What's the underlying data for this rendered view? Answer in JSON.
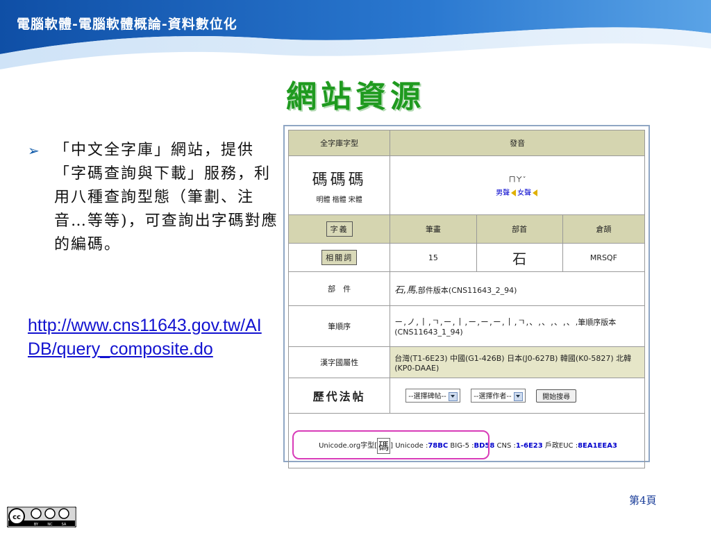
{
  "deck_title": "電腦軟體-電腦軟體概論-資料數位化",
  "slide_title": "網站資源",
  "bullet": {
    "text": "「中文全字庫」網站，提供「字碼查詢與下載」服務，利用八種查詢型態（筆劃、注音…等等)，可查詢出字碼對應的編碼。"
  },
  "link": "http://www.cns11643.gov.tw/AIDB/query_composite.do",
  "screenshot": {
    "header": {
      "glyph_col": "全字庫字型",
      "pron_col": "發音"
    },
    "glyphs": "碼碼碼",
    "glyph_names": "明體 楷體 宋體",
    "zhuyin": "ㄇㄚˇ",
    "voice_male": "男聲",
    "voice_female": "女聲",
    "meaning_button": "字義",
    "sub_headers": [
      "筆畫",
      "部首",
      "倉頡"
    ],
    "related_button": "相關詞",
    "stroke_count": "15",
    "radical": "石",
    "cangjie": "MRSQF",
    "components_label": "部　件",
    "components_glyphs": "石,馬",
    "components_version": ",部件版本(CNS11643_2_94)",
    "stroke_order_label": "筆順序",
    "stroke_order_sequence": "ㄧ,ノ,丨,ㄱ,ㄧ,丨,ㄧ,ㄧ,ㄧ,丨,ㄱ,、,、,、,、",
    "stroke_order_version": ",筆順序版本(CNS11643_1_94)",
    "attr_label": "漢字國屬性",
    "attr_value": "台灣(T1-6E23) 中國(G1-426B) 日本(J0-627B) 韓國(K0-5827) 北韓(KP0-DAAE)",
    "calli_label": "歷代法帖",
    "select_stele": "--選擇碑帖--",
    "select_author": "--選擇作者--",
    "search_button": "開始搜尋",
    "code": {
      "unicode_org_label": "Unicode.org字型",
      "char": "碼",
      "unicode_label": "Unicode :",
      "unicode_value": "78BC",
      "big5_label": "BIG-5 :",
      "big5_value": "BD58",
      "cns_label": "CNS :",
      "cns_value": "1-6E23",
      "euc_label": "戶政EUC :",
      "euc_value": "8EA1EEA3"
    }
  },
  "page_number": "第4頁",
  "license": {
    "cc": "cc",
    "by": "BY",
    "nc": "NC",
    "sa": "SA"
  },
  "colors": {
    "title_green": "#1f9a1f",
    "header_blue": "#1d63b8",
    "link_blue": "#1212d0",
    "highlight_magenta": "#d83bb8",
    "table_header": "#d5d5b0"
  }
}
